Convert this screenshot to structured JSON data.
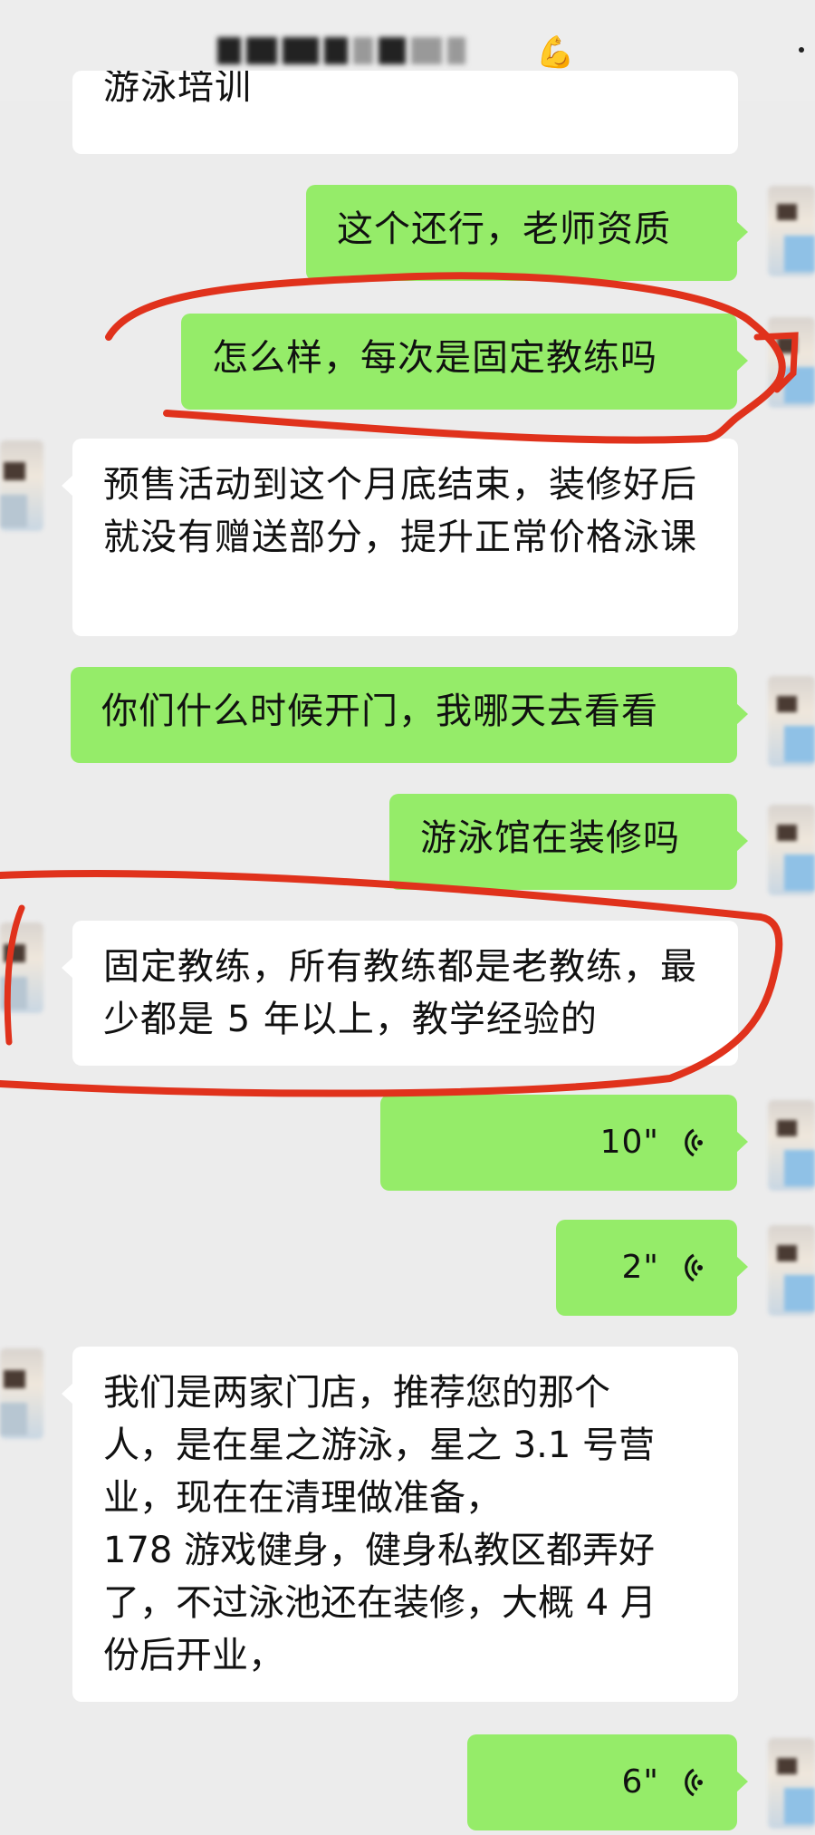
{
  "header": {
    "title_icon": "flexed-biceps-emoji",
    "more_icon": "more-dots-icon"
  },
  "messages": [
    {
      "side": "in",
      "text": "游泳培训"
    },
    {
      "side": "out",
      "text": "这个还行，老师资质"
    },
    {
      "side": "out",
      "text": "怎么样，每次是固定教练吗",
      "highlighted": true
    },
    {
      "side": "in",
      "text": "预售活动到这个月底结束，装修好后就没有赠送部分，提升正常价格泳课"
    },
    {
      "side": "out",
      "text": "你们什么时候开门，我哪天去看看"
    },
    {
      "side": "out",
      "text": "游泳馆在装修吗"
    },
    {
      "side": "in",
      "text": "固定教练，所有教练都是老教练，最少都是 5 年以上，教学经验的",
      "highlighted": true
    },
    {
      "side": "out",
      "type": "voice",
      "duration": "10\""
    },
    {
      "side": "out",
      "type": "voice",
      "duration": "2\""
    },
    {
      "side": "in",
      "lines": [
        "我们是两家门店，推荐您的那个",
        "人，是在星之游泳，星之 3.1 号营",
        "业，现在在清理做准备，",
        "178 游戏健身，健身私教区都弄好",
        "了，不过泳池还在装修，大概 4 月",
        "份后开业，"
      ]
    },
    {
      "side": "out",
      "type": "voice",
      "duration": "6\""
    }
  ],
  "colors": {
    "outgoing_bubble": "#95ec69",
    "incoming_bubble": "#ffffff",
    "background": "#ececec",
    "annotation": "#e0321c"
  }
}
